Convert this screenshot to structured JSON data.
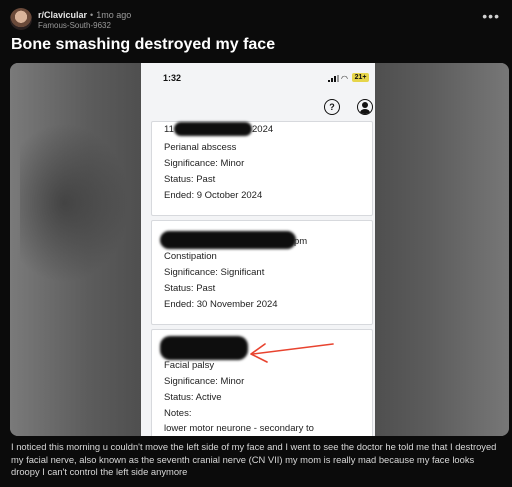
{
  "post": {
    "subreddit": "r/Clavicular",
    "separator": "•",
    "age": "1mo ago",
    "username": "Famous-South-9632",
    "more_icon": "ellipsis-icon",
    "title": "Bone smashing destroyed my face",
    "body": "I noticed this morning u couldn't move the left side of my face and I went to see the doctor he told me that I destroyed my facial nerve, also known as the seventh cranial nerve (CN VII) my mom is really mad because my face looks droopy I can't control the left side anymore"
  },
  "phone": {
    "time": "1:32",
    "battery": "21+",
    "help_glyph": "?",
    "cards": [
      {
        "date_partial": "11",
        "date_tail": "2024",
        "condition": "Perianal abscess",
        "significance": "Significance: Minor",
        "status": "Status: Past",
        "ended": "Ended: 9 October 2024"
      },
      {
        "date_tail": "pm",
        "condition": "Constipation",
        "significance": "Significance: Significant",
        "status": "Status: Past",
        "ended": "Ended: 30 November 2024"
      },
      {
        "condition": "Facial palsy",
        "significance": "Significance: Minor",
        "status": "Status: Active",
        "notes_label": "Notes:",
        "notes": "lower motor neurone - secondary to"
      }
    ]
  },
  "colors": {
    "page_bg": "#0b0b0b",
    "arrow": "#e8432f",
    "battery": "#e6d54a"
  }
}
